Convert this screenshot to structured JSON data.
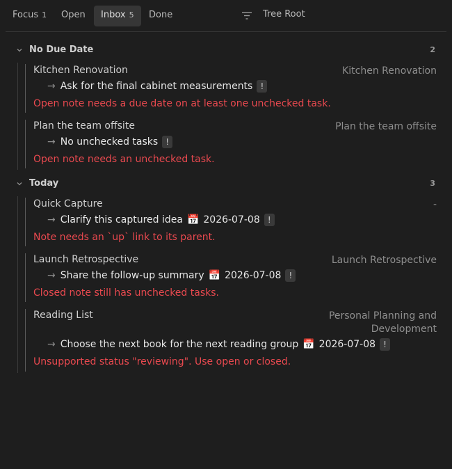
{
  "tabs": [
    {
      "label": "Focus",
      "count": "1"
    },
    {
      "label": "Open",
      "count": ""
    },
    {
      "label": "Inbox",
      "count": "5"
    },
    {
      "label": "Done",
      "count": ""
    }
  ],
  "active_tab": "Inbox",
  "filter_icon": "filter-icon",
  "tree_root": "Tree Root",
  "groups": [
    {
      "title": "No Due Date",
      "count": "2",
      "notes": [
        {
          "title": "Kitchen Renovation",
          "parent": "Kitchen Renovation",
          "task": {
            "arrow": "→",
            "text": "Ask for the final cabinet measurements",
            "date": "",
            "flag": "!"
          },
          "error": "Open note needs a due date on at least one unchecked task."
        },
        {
          "title": "Plan the team offsite",
          "parent": "Plan the team offsite",
          "task": {
            "arrow": "→",
            "text": "No unchecked tasks",
            "date": "",
            "flag": "!"
          },
          "error": "Open note needs an unchecked task."
        }
      ]
    },
    {
      "title": "Today",
      "count": "3",
      "notes": [
        {
          "title": "Quick Capture",
          "parent": "-",
          "task": {
            "arrow": "→",
            "text": "Clarify this captured idea",
            "cal": "📅",
            "date": "2026-07-08",
            "flag": "!"
          },
          "error": "Note needs an `up` link to its parent."
        },
        {
          "title": "Launch Retrospective",
          "parent": "Launch Retrospective",
          "task": {
            "arrow": "→",
            "text": "Share the follow-up summary",
            "cal": "📅",
            "date": "2026-07-08",
            "flag": "!"
          },
          "error": "Closed note still has unchecked tasks."
        },
        {
          "title": "Reading List",
          "parent_lines": [
            "Personal Planning and",
            "Development"
          ],
          "task": {
            "arrow": "→",
            "text": "Choose the next book for the next reading group",
            "cal": "📅",
            "date": "2026-07-08",
            "flag": "!"
          },
          "error": "Unsupported status \"reviewing\". Use open or closed."
        }
      ]
    }
  ],
  "colors": {
    "background": "#1e1e1e",
    "error": "#e9494f",
    "active_tab": "#363636",
    "muted": "#8e8e8e"
  }
}
